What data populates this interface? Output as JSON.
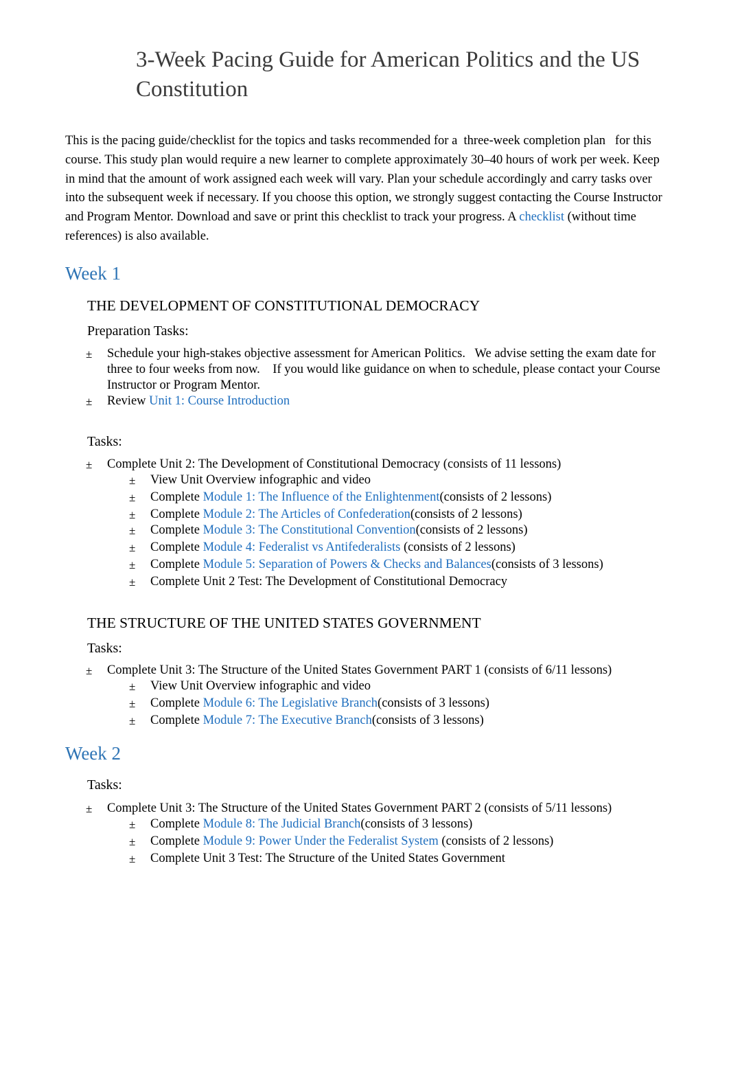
{
  "document": {
    "title": "3-Week Pacing Guide for American Politics and the US Constitution",
    "intro": {
      "text": "This is the pacing guide/checklist for the topics and tasks recommended for a  three-week completion plan   for this course. This study plan would require a new learner to complete approximately 30–40 hours of work per week. Keep in mind that the amount of work assigned each week will vary. Plan your schedule accordingly and carry tasks over into the subsequent week if necessary. If you choose this option, we strongly suggest contacting the Course Instructor and Program Mentor. Download and save or print this checklist to track your progress. A ",
      "link": "checklist",
      "after_link": " (without time references) is also available."
    },
    "bullet_symbol": "±",
    "colors": {
      "heading_blue": "#2e74b5",
      "link_blue": "#1f6fbf",
      "title_gray": "#3a3a3a"
    },
    "week1": {
      "heading": "Week 1",
      "section1": {
        "title": "THE DEVELOPMENT OF CONSTITUTIONAL DEMOCRACY",
        "prep_label": "Preparation Tasks:",
        "prep_items": [
          {
            "text": "Schedule your high-stakes objective assessment for American Politics.   We advise setting the exam date for three to four weeks from now.    If you would like guidance on when to schedule, please contact your Course Instructor or Program Mentor."
          },
          {
            "prefix": "Review ",
            "link": "Unit 1: Course Introduction"
          }
        ],
        "tasks_label": "Tasks:",
        "unit": "Complete Unit 2: The Development of Constitutional Democracy (consists of 11 lessons)",
        "subitems": [
          {
            "prefix": "View Unit Overview infographic and video"
          },
          {
            "prefix": "Complete ",
            "link": "Module 1: The Influence of the Enlightenment",
            "suffix": "(consists of 2 lessons)"
          },
          {
            "prefix": "Complete ",
            "link": "Module 2: The Articles of Confederation",
            "suffix": "(consists of 2 lessons)"
          },
          {
            "prefix": "Complete ",
            "link": "Module 3: The Constitutional Convention",
            "suffix": "(consists of 2 lessons)"
          },
          {
            "prefix": "Complete ",
            "link": "Module 4: Federalist vs Antifederalists",
            "suffix": " (consists of 2 lessons)"
          },
          {
            "prefix": "Complete ",
            "link": "Module 5: Separation of Powers & Checks and Balances",
            "suffix": "(consists of 3 lessons)"
          },
          {
            "prefix": "Complete Unit 2 Test: The Development of Constitutional Democracy"
          }
        ]
      },
      "section2": {
        "title": "THE STRUCTURE OF THE UNITED STATES GOVERNMENT",
        "tasks_label": "Tasks:",
        "unit": "Complete Unit 3: The Structure of the United States Government PART 1 (consists of 6/11 lessons)",
        "subitems": [
          {
            "prefix": "View Unit Overview infographic and video"
          },
          {
            "prefix": "Complete ",
            "link": "Module 6: The Legislative Branch",
            "suffix": "(consists of 3 lessons)"
          },
          {
            "prefix": "Complete ",
            "link": "Module 7: The Executive Branch",
            "suffix": "(consists of 3 lessons)"
          }
        ]
      }
    },
    "week2": {
      "heading": "Week 2",
      "tasks_label": "Tasks:",
      "unit": "Complete Unit 3: The Structure of the United States Government PART 2 (consists of 5/11 lessons)",
      "subitems": [
        {
          "prefix": "Complete ",
          "link": "Module 8: The Judicial Branch",
          "suffix": "(consists of 3 lessons)"
        },
        {
          "prefix": "Complete ",
          "link": "Module 9: Power Under the Federalist System",
          "suffix": " (consists of 2 lessons)"
        },
        {
          "prefix": "Complete Unit 3 Test: The Structure of the United States Government"
        }
      ]
    }
  }
}
